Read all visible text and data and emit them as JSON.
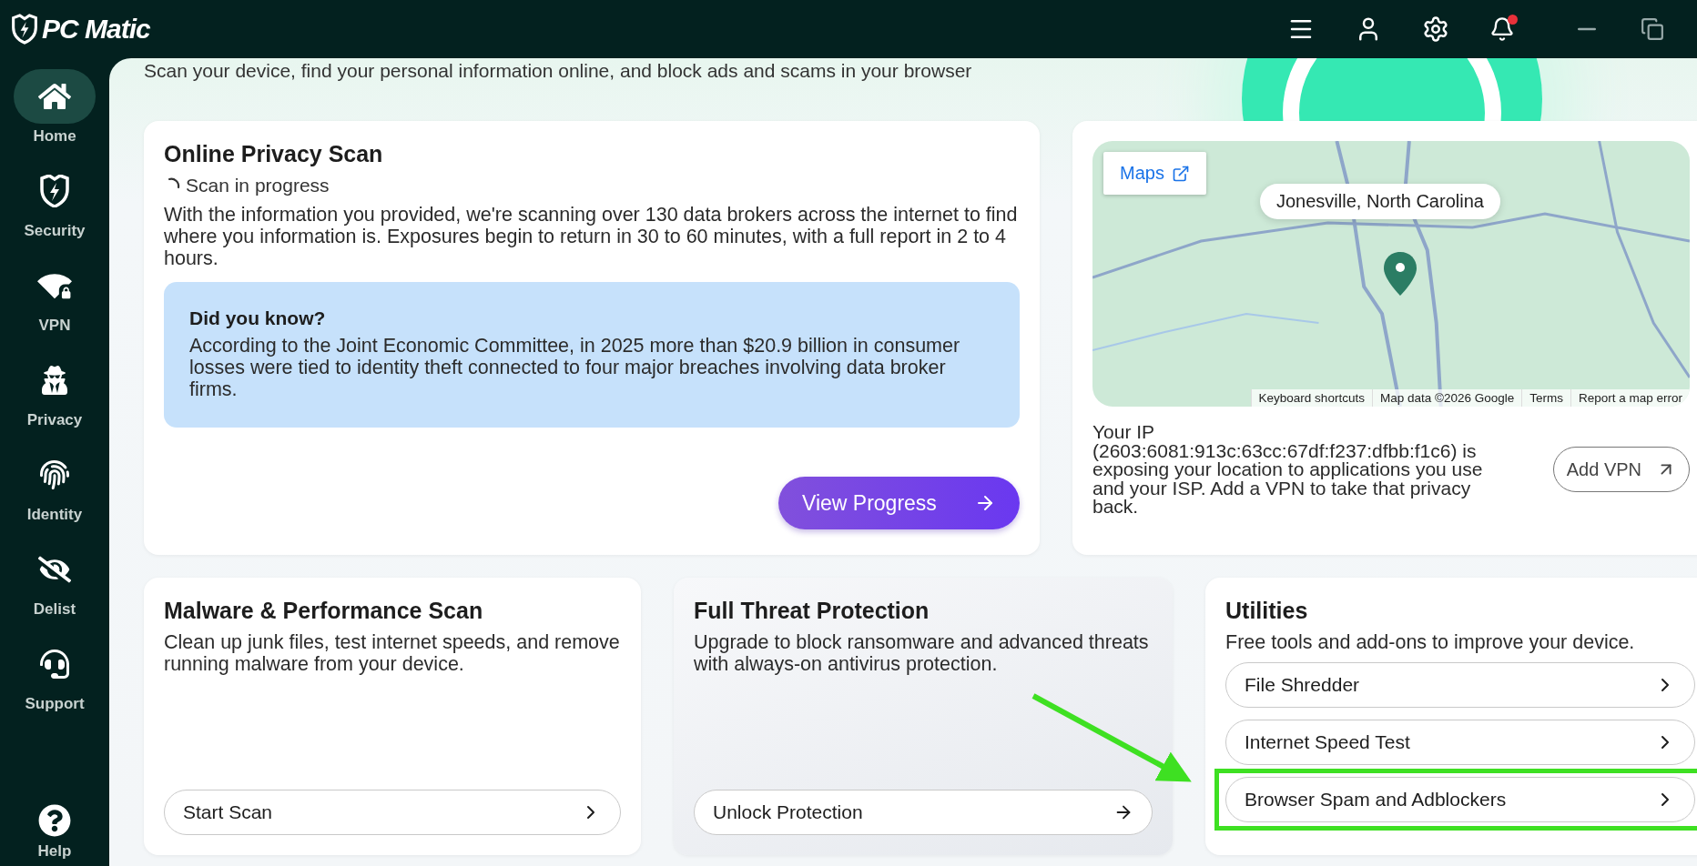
{
  "app": {
    "name": "PC Matic"
  },
  "notifications": {
    "unread": true
  },
  "sidebar": {
    "items": [
      {
        "label": "Home",
        "kind": "home",
        "selected": true
      },
      {
        "label": "Security",
        "kind": "security",
        "selected": false
      },
      {
        "label": "VPN",
        "kind": "vpn",
        "selected": false
      },
      {
        "label": "Privacy",
        "kind": "privacy",
        "selected": false
      },
      {
        "label": "Identity",
        "kind": "identity",
        "selected": false
      },
      {
        "label": "Delist",
        "kind": "delist",
        "selected": false
      },
      {
        "label": "Support",
        "kind": "support",
        "selected": false
      }
    ],
    "help": {
      "label": "Help"
    }
  },
  "banner": {
    "text": "Scan your device, find your personal information online, and block ads and scams in your browser"
  },
  "privacy_scan": {
    "title": "Online Privacy Scan",
    "status": "Scan in progress",
    "description": "With the information you provided, we're scanning over 130 data brokers across the internet to find where you information is. Exposures begin to return in 30 to 60 minutes, with a full report in 2 to 4 hours.",
    "tip": {
      "title": "Did you know?",
      "text": "According to the Joint Economic Committee, in 2025 more than $20.9 billion in consumer losses were tied to identity theft connected to four major breaches involving data broker firms."
    },
    "button": "View Progress"
  },
  "location": {
    "maps_link": "Maps",
    "place": "Jonesville, North Carolina",
    "attribution": [
      "Keyboard shortcuts",
      "Map data ©2026 Google",
      "Terms",
      "Report a map error"
    ],
    "ip_text": "Your IP (2603:6081:913c:63cc:67df:f237:dfbb:f1c6) is exposing your location to applications you use and your ISP. Add a VPN to take that privacy back.",
    "button": "Add VPN"
  },
  "cards": [
    {
      "title": "Malware & Performance Scan",
      "text": "Clean up junk files, test internet speeds, and remove running malware from your device.",
      "button": "Start Scan",
      "kind": "plain"
    },
    {
      "title": "Full Threat Protection",
      "text": "Upgrade to block ransomware and advanced threats with always-on antivirus protection.",
      "button": "Unlock Protection",
      "kind": "locked"
    }
  ],
  "utilities": {
    "title": "Utilities",
    "text": "Free tools and add-ons to improve your device.",
    "items": [
      {
        "label": "File Shredder",
        "highlighted": false
      },
      {
        "label": "Internet Speed Test",
        "highlighted": false
      },
      {
        "label": "Browser Spam and Adblockers",
        "highlighted": true
      }
    ]
  }
}
